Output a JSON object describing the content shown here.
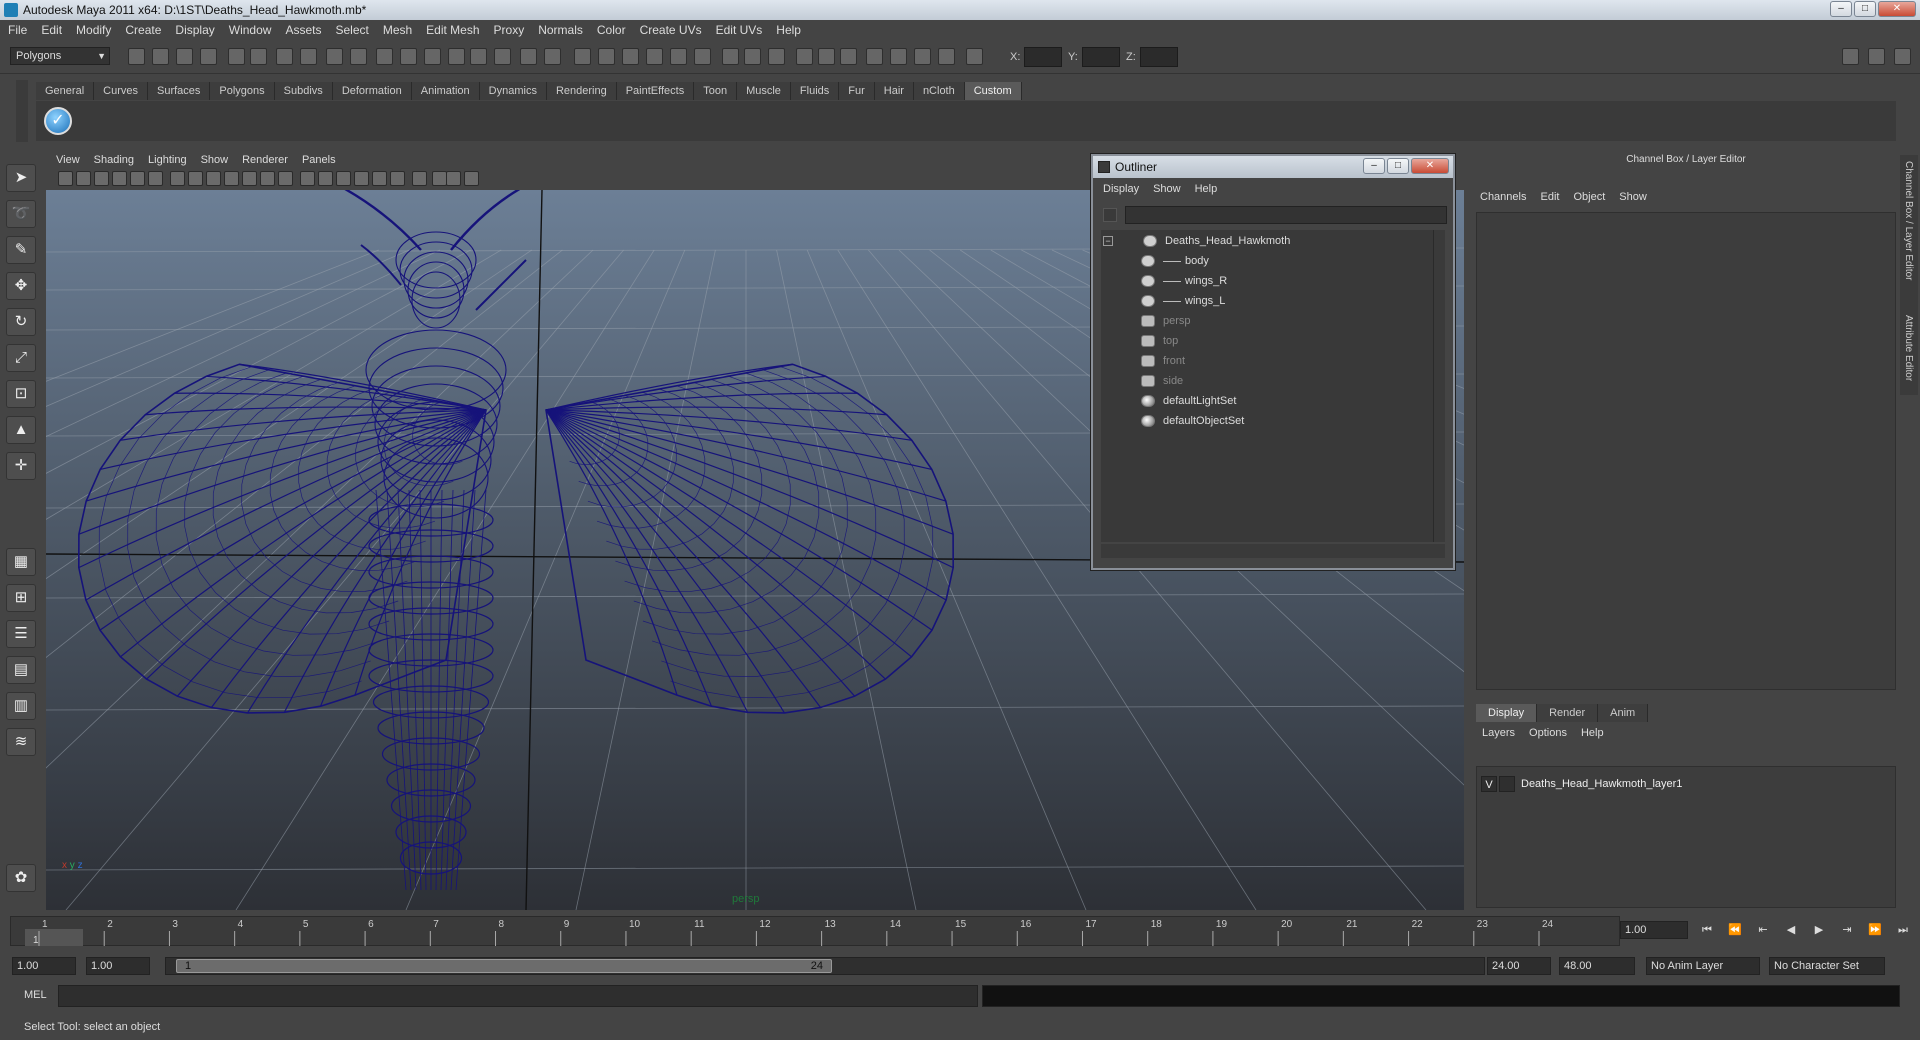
{
  "window": {
    "title": "Autodesk Maya 2011 x64: D:\\1ST\\Deaths_Head_Hawkmoth.mb*",
    "controls": [
      "minimize",
      "maximize",
      "close"
    ]
  },
  "menubar": [
    "File",
    "Edit",
    "Modify",
    "Create",
    "Display",
    "Window",
    "Assets",
    "Select",
    "Mesh",
    "Edit Mesh",
    "Proxy",
    "Normals",
    "Color",
    "Create UVs",
    "Edit UVs",
    "Help"
  ],
  "statusline": {
    "mode": "Polygons",
    "x_label": "X:",
    "y_label": "Y:",
    "z_label": "Z:"
  },
  "shelf": {
    "tabs": [
      "General",
      "Curves",
      "Surfaces",
      "Polygons",
      "Subdivs",
      "Deformation",
      "Animation",
      "Dynamics",
      "Rendering",
      "PaintEffects",
      "Toon",
      "Muscle",
      "Fluids",
      "Fur",
      "Hair",
      "nCloth",
      "Custom"
    ],
    "active_tab": "Custom",
    "check_icon": "✓"
  },
  "toolbox": {
    "icons": [
      "select-tool-icon",
      "lasso-tool-icon",
      "paint-select-icon",
      "move-tool-icon",
      "rotate-tool-icon",
      "scale-tool-icon",
      "manipulator-icon",
      "soft-mod-icon",
      "last-tool-icon"
    ]
  },
  "viewport": {
    "menu": [
      "View",
      "Shading",
      "Lighting",
      "Show",
      "Renderer",
      "Panels"
    ],
    "camera_label": "persp",
    "mesh_color": "#16137a",
    "axis": {
      "x": "x",
      "y": "y",
      "z": "z"
    }
  },
  "outliner": {
    "title": "Outliner",
    "menu": [
      "Display",
      "Show",
      "Help"
    ],
    "items": [
      {
        "label": "Deaths_Head_Hawkmoth",
        "kind": "group",
        "dim": false
      },
      {
        "label": "body",
        "kind": "mesh",
        "dim": false
      },
      {
        "label": "wings_R",
        "kind": "mesh",
        "dim": false
      },
      {
        "label": "wings_L",
        "kind": "mesh",
        "dim": false
      },
      {
        "label": "persp",
        "kind": "camera",
        "dim": true
      },
      {
        "label": "top",
        "kind": "camera",
        "dim": true
      },
      {
        "label": "front",
        "kind": "camera",
        "dim": true
      },
      {
        "label": "side",
        "kind": "camera",
        "dim": true
      },
      {
        "label": "defaultLightSet",
        "kind": "set",
        "dim": false
      },
      {
        "label": "defaultObjectSet",
        "kind": "set",
        "dim": false
      }
    ],
    "collapse_symbol": "−"
  },
  "channel_box": {
    "header": "Channel Box / Layer Editor",
    "menu": [
      "Channels",
      "Edit",
      "Object",
      "Show"
    ],
    "side_tabs": [
      "Channel Box / Layer Editor",
      "Attribute Editor"
    ]
  },
  "layer_editor": {
    "tabs": [
      "Display",
      "Render",
      "Anim"
    ],
    "active_tab": "Display",
    "menu": [
      "Layers",
      "Options",
      "Help"
    ],
    "layers": [
      {
        "visible": "V",
        "name": "Deaths_Head_Hawkmoth_layer1"
      }
    ]
  },
  "timeslider": {
    "ticks": [
      "1",
      "2",
      "3",
      "4",
      "5",
      "6",
      "7",
      "8",
      "9",
      "10",
      "11",
      "12",
      "13",
      "14",
      "15",
      "16",
      "17",
      "18",
      "19",
      "20",
      "21",
      "22",
      "23",
      "24"
    ],
    "current_frame_marker": "1",
    "current_frame": "1.00",
    "playback_buttons": [
      "⏮",
      "⏪",
      "⇤",
      "◀",
      "▶",
      "⇥",
      "⏩",
      "⏭"
    ]
  },
  "range": {
    "start": "1.00",
    "playback_start": "1.00",
    "thumb_start": "1",
    "thumb_end": "24",
    "playback_end": "24.00",
    "end": "48.00",
    "anim_layer": "No Anim Layer",
    "character_set": "No Character Set"
  },
  "command_line": {
    "label": "MEL",
    "input": ""
  },
  "help_line": "Select Tool: select an object",
  "colors": {
    "ui_bg": "#444444",
    "panel_bg": "#3d3d3d",
    "wireframe": "#16137a",
    "grid": "#9aa3ae"
  }
}
